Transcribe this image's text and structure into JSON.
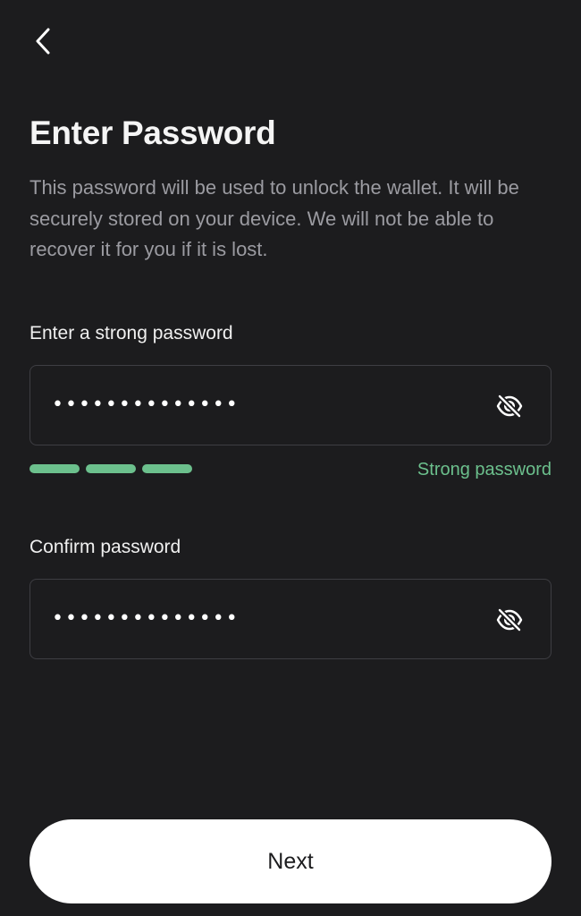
{
  "header": {
    "back_icon": "chevron-left-icon"
  },
  "page": {
    "title": "Enter Password",
    "description": "This password will be used to unlock the wallet. It will be securely stored on your device. We will not be able to recover it for you if it is lost."
  },
  "password_field": {
    "label": "Enter a strong password",
    "value": "••••••••••••••",
    "toggle_icon": "eye-slash-icon"
  },
  "strength": {
    "label": "Strong password",
    "level_segments_filled": 3,
    "color": "#6cc08d"
  },
  "confirm_field": {
    "label": "Confirm password",
    "value": "••••••••••••••",
    "toggle_icon": "eye-slash-icon"
  },
  "footer": {
    "next_label": "Next"
  },
  "colors": {
    "background": "#1c1c1e",
    "button_bg": "#ffffff",
    "accent_green": "#6cc08d",
    "muted_text": "#9b9ba1"
  }
}
